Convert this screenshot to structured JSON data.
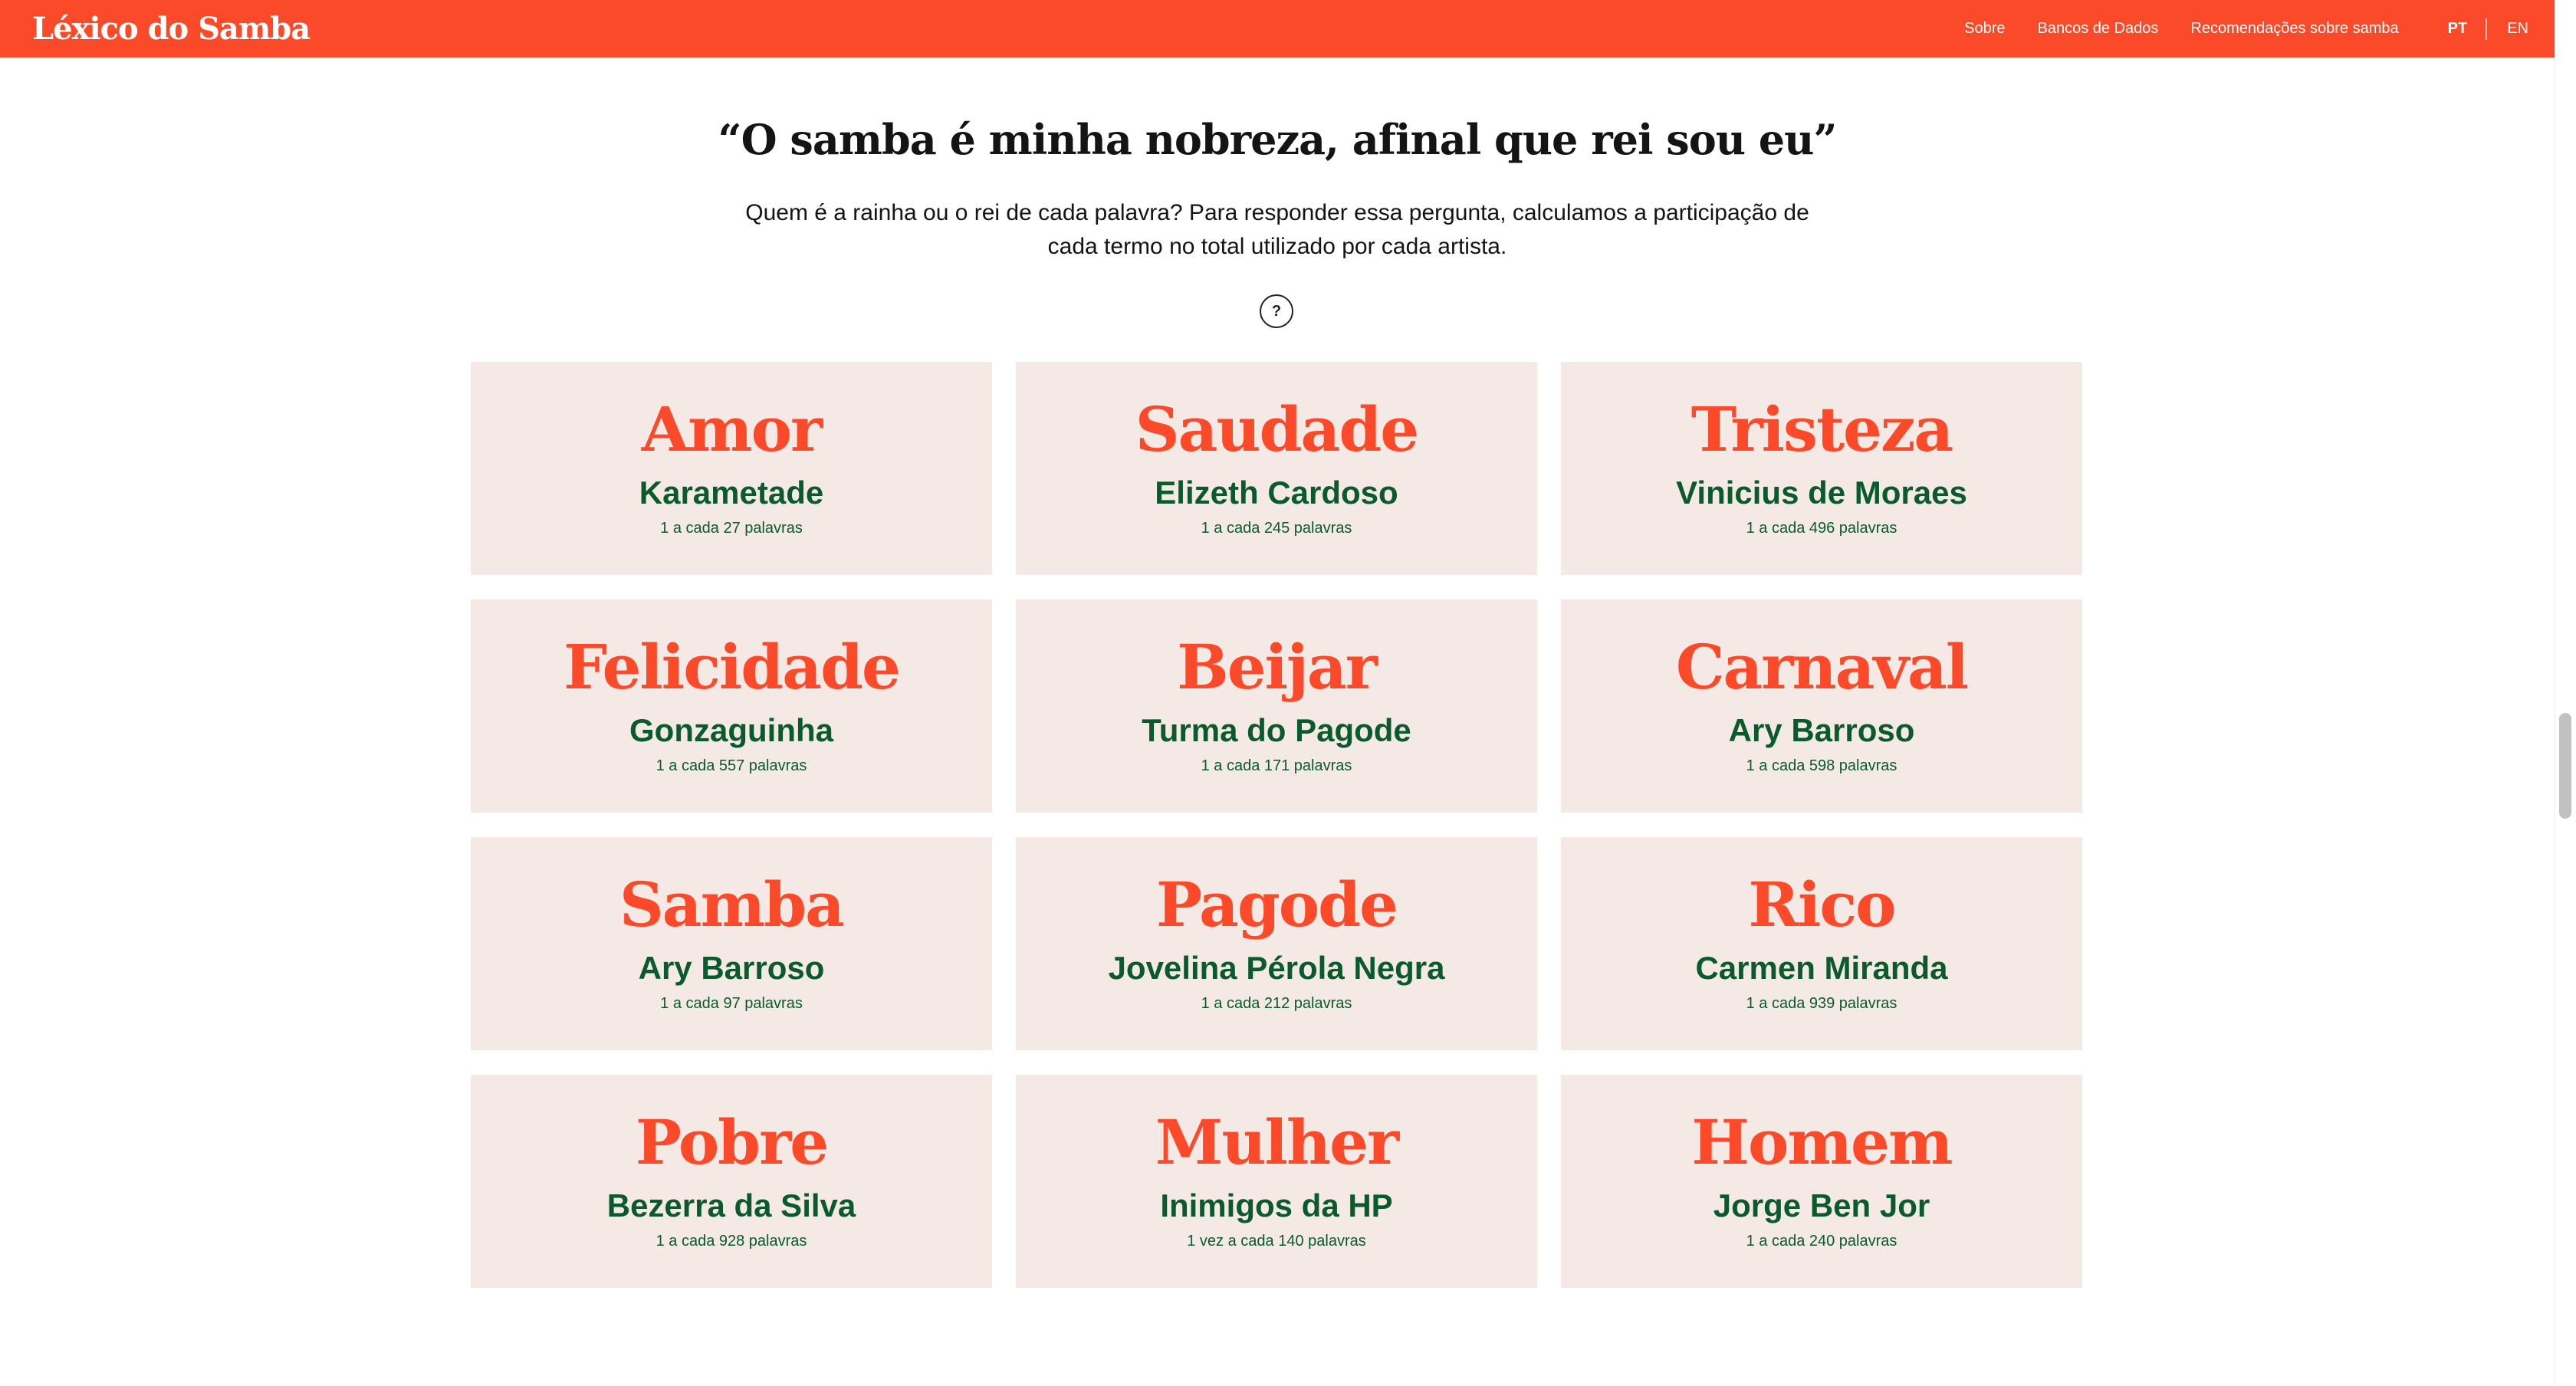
{
  "header": {
    "logo": "Léxico do Samba",
    "nav": [
      "Sobre",
      "Bancos de Dados",
      "Recomendações sobre samba"
    ],
    "lang_active": "PT",
    "lang_other": "EN",
    "background_color": "#fb4a2a"
  },
  "intro": {
    "title": "“O samba é minha nobreza, afinal que rei sou eu”",
    "subtitle": "Quem é a rainha ou o rei de cada palavra? Para responder essa pergunta, calculamos a participação de cada termo no total utilizado por cada artista.",
    "help_label": "?"
  },
  "colors": {
    "word": "#fb4a2a",
    "artist": "#0b5a2b",
    "card_bg": "#f5e9e6"
  },
  "cards": [
    {
      "word": "Amor",
      "artist": "Karametade",
      "freq": "1 a cada 27 palavras"
    },
    {
      "word": "Saudade",
      "artist": "Elizeth Cardoso",
      "freq": "1 a cada 245 palavras"
    },
    {
      "word": "Tristeza",
      "artist": "Vinicius de Moraes",
      "freq": "1 a cada 496 palavras"
    },
    {
      "word": "Felicidade",
      "artist": "Gonzaguinha",
      "freq": "1 a cada 557 palavras"
    },
    {
      "word": "Beijar",
      "artist": "Turma do Pagode",
      "freq": "1 a cada 171 palavras"
    },
    {
      "word": "Carnaval",
      "artist": "Ary Barroso",
      "freq": "1 a cada 598 palavras"
    },
    {
      "word": "Samba",
      "artist": "Ary Barroso",
      "freq": "1 a cada 97 palavras"
    },
    {
      "word": "Pagode",
      "artist": "Jovelina Pérola Negra",
      "freq": "1 a cada 212 palavras"
    },
    {
      "word": "Rico",
      "artist": "Carmen Miranda",
      "freq": "1 a cada 939 palavras"
    },
    {
      "word": "Pobre",
      "artist": "Bezerra da Silva",
      "freq": "1 a cada 928 palavras"
    },
    {
      "word": "Mulher",
      "artist": "Inimigos da HP",
      "freq": "1 vez a cada 140 palavras"
    },
    {
      "word": "Homem",
      "artist": "Jorge Ben Jor",
      "freq": "1 a cada 240 palavras"
    }
  ]
}
